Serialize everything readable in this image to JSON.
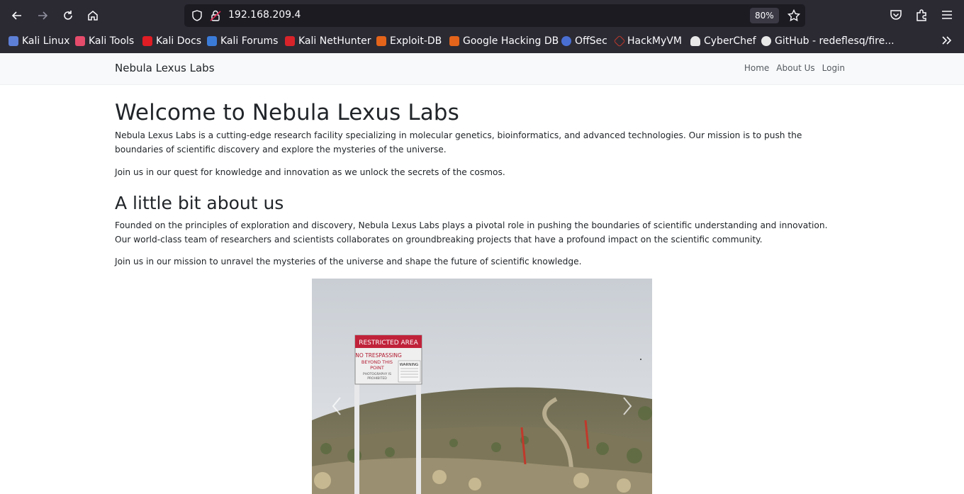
{
  "browser": {
    "url": "192.168.209.4",
    "zoom": "80%",
    "bookmarks": [
      {
        "label": "Kali Linux",
        "icon": "kali-dragon-icon",
        "color": "#5d7fd6"
      },
      {
        "label": "Kali Tools",
        "icon": "kali-tools-icon",
        "color": "#e54b6b"
      },
      {
        "label": "Kali Docs",
        "icon": "kali-docs-icon",
        "color": "#e01c24"
      },
      {
        "label": "Kali Forums",
        "icon": "kali-forums-icon",
        "color": "#3b7bd8"
      },
      {
        "label": "Kali NetHunter",
        "icon": "kali-nethunter-icon",
        "color": "#d8232a"
      },
      {
        "label": "Exploit-DB",
        "icon": "exploit-db-icon",
        "color": "#e3641a"
      },
      {
        "label": "Google Hacking DB",
        "icon": "ghdb-icon",
        "color": "#e3641a"
      },
      {
        "label": "OffSec",
        "icon": "offsec-icon",
        "color": "#4a6fd3"
      },
      {
        "label": "HackMyVM",
        "icon": "hackmyvm-icon",
        "color": "#c0392b"
      },
      {
        "label": "CyberChef",
        "icon": "cyberchef-icon",
        "color": "#e8e8e8"
      },
      {
        "label": "GitHub - redeflesq/fire...",
        "icon": "github-icon",
        "color": "#e8e8e8"
      }
    ]
  },
  "site": {
    "brand": "Nebula Lexus Labs",
    "nav": [
      "Home",
      "About Us",
      "Login"
    ]
  },
  "content": {
    "heading": "Welcome to Nebula Lexus Labs",
    "intro_p1": "Nebula Lexus Labs is a cutting-edge research facility specializing in molecular genetics, bioinformatics, and advanced technologies. Our mission is to push the boundaries of scientific discovery and explore the mysteries of the universe.",
    "intro_p2": "Join us in our quest for knowledge and innovation as we unlock the secrets of the cosmos.",
    "about_heading": "A little bit about us",
    "about_p1": "Founded on the principles of exploration and discovery, Nebula Lexus Labs plays a pivotal role in pushing the boundaries of scientific understanding and innovation. Our world-class team of researchers and scientists collaborates on groundbreaking projects that have a profound impact on the scientific community.",
    "about_p2": "Join us in our mission to unravel the mysteries of the universe and shape the future of scientific knowledge."
  },
  "carousel": {
    "sign_lines": [
      "RESTRICTED AREA",
      "NO TRESPASSING",
      "BEYOND THIS",
      "POINT",
      "PHOTOGRAPHY IS",
      "PROHIBITED",
      "WARNING"
    ]
  }
}
